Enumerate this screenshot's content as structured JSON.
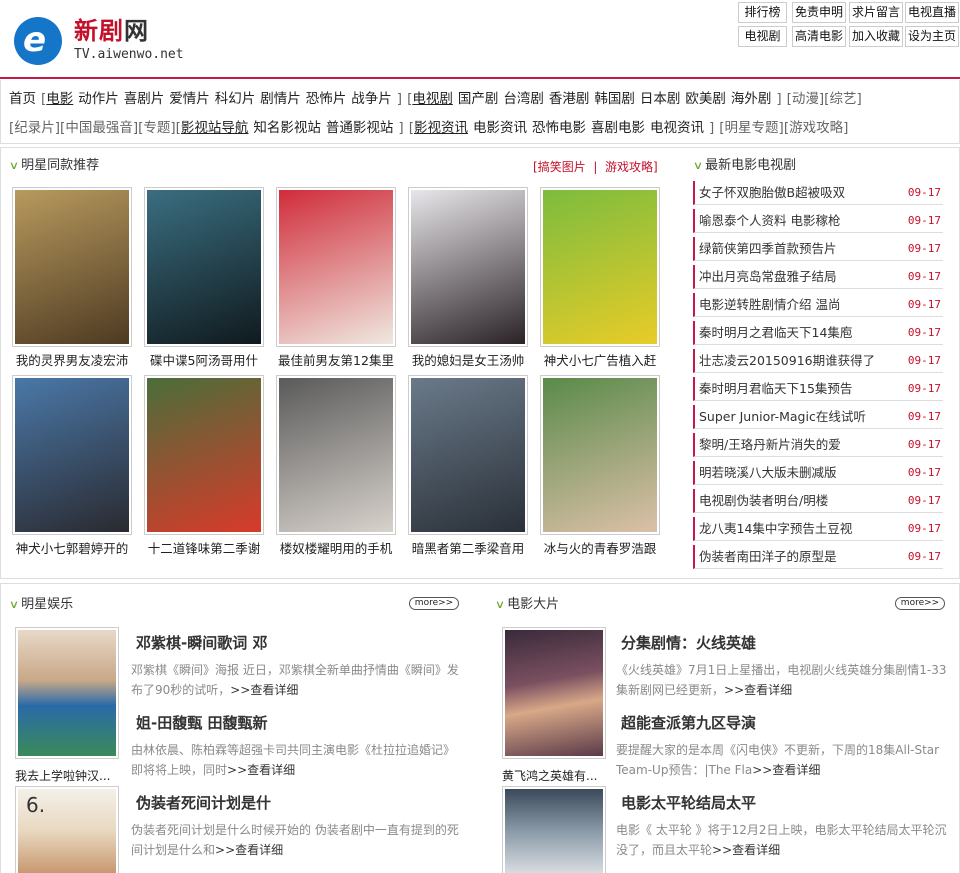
{
  "site": {
    "name_part1": "新剧",
    "name_part2": "网",
    "domain": "TV.aiwenwo.net"
  },
  "top_links": [
    "排行榜",
    "免责申明",
    "求片留言",
    "电视直播",
    "电视剧",
    "高清电影",
    "加入收藏",
    "设为主页"
  ],
  "nav": {
    "row1": [
      {
        "t": "首页"
      },
      {
        "t": "[",
        "b": 1
      },
      {
        "t": "电影",
        "u": 1
      },
      {
        "t": "动作片"
      },
      {
        "t": "喜剧片"
      },
      {
        "t": "爱情片"
      },
      {
        "t": "科幻片"
      },
      {
        "t": "剧情片"
      },
      {
        "t": "恐怖片"
      },
      {
        "t": "战争片"
      },
      {
        "t": "]",
        "b": 1
      },
      {
        "t": "[",
        "b": 1
      },
      {
        "t": "电视剧",
        "u": 1
      },
      {
        "t": "国产剧"
      },
      {
        "t": "台湾剧"
      },
      {
        "t": "香港剧"
      },
      {
        "t": "韩国剧"
      },
      {
        "t": "日本剧"
      },
      {
        "t": "欧美剧"
      },
      {
        "t": "海外剧"
      },
      {
        "t": "]",
        "b": 1
      },
      {
        "t": "[动漫]",
        "b": 1
      },
      {
        "t": "[综艺]",
        "b": 1
      }
    ],
    "row2": [
      {
        "t": "[纪录片]",
        "b": 1
      },
      {
        "t": "[中国最强音]",
        "b": 1
      },
      {
        "t": "[专题]",
        "b": 1
      },
      {
        "t": "[",
        "b": 1
      },
      {
        "t": "影视站导航",
        "u": 1
      },
      {
        "t": "知名影视站"
      },
      {
        "t": "普通影视站"
      },
      {
        "t": "]",
        "b": 1
      },
      {
        "t": "[",
        "b": 1
      },
      {
        "t": "影视资讯",
        "u": 1
      },
      {
        "t": "电影资讯"
      },
      {
        "t": "恐怖电影"
      },
      {
        "t": "喜剧电影"
      },
      {
        "t": "电视资讯"
      },
      {
        "t": "]",
        "b": 1
      },
      {
        "t": "[明星专题]",
        "b": 1
      },
      {
        "t": "[游戏攻略]",
        "b": 1
      }
    ]
  },
  "star_rec": {
    "title": "明星同款推荐",
    "tag_links": [
      "搞笑图片",
      "游戏攻略"
    ],
    "items": [
      {
        "label": "我的灵界男友凌宏沛",
        "c1": "#b89a5e",
        "c2": "#4e3a22"
      },
      {
        "label": "碟中谍5阿汤哥用什",
        "c1": "#3a6e80",
        "c2": "#101a1e"
      },
      {
        "label": "最佳前男友第12集里",
        "c1": "#d02c3a",
        "c2": "#f0e8e0"
      },
      {
        "label": "我的媳妇是女王汤帅",
        "c1": "#e8e6ea",
        "c2": "#2a2226"
      },
      {
        "label": "神犬小七广告植入赶",
        "c1": "#7cbc3e",
        "c2": "#e8cc28"
      },
      {
        "label": "神犬小七郭碧婷开的",
        "c1": "#4a78a8",
        "c2": "#2a2a30"
      },
      {
        "label": "十二道锋味第二季谢",
        "c1": "#4a6e3a",
        "c2": "#d83a2a"
      },
      {
        "label": "楼奴楼耀明用的手机",
        "c1": "#5a5a5a",
        "c2": "#d8d2cc"
      },
      {
        "label": "暗黑者第二季梁音用",
        "c1": "#6a7a8a",
        "c2": "#2a3038"
      },
      {
        "label": "冰与火的青春罗浩跟",
        "c1": "#5a8a4a",
        "c2": "#dcc0a8"
      }
    ]
  },
  "latest": {
    "title": "最新电影电视剧",
    "items": [
      {
        "t": "女子怀双胞胎傲B超被吸双",
        "d": "09-17"
      },
      {
        "t": "喻恩泰个人资料 电影稼枪",
        "d": "09-17"
      },
      {
        "t": "绿箭侠第四季首款预告片",
        "d": "09-17"
      },
      {
        "t": "冲出月亮岛常盘雅子结局",
        "d": "09-17"
      },
      {
        "t": "电影逆转胜剧情介绍 温尚",
        "d": "09-17"
      },
      {
        "t": "秦时明月之君临天下14集庖",
        "d": "09-17"
      },
      {
        "t": "壮志凌云20150916期谁获得了",
        "d": "09-17"
      },
      {
        "t": "秦时明月君临天下15集预告",
        "d": "09-17"
      },
      {
        "t": "Super Junior-Magic在线试听",
        "d": "09-17"
      },
      {
        "t": "黎明/王珞丹新片消失的爱",
        "d": "09-17"
      },
      {
        "t": "明若晓溪八大版未删减版",
        "d": "09-17"
      },
      {
        "t": "电视剧伪装者明台/明楼",
        "d": "09-17"
      },
      {
        "t": "龙八夷14集中字预告土豆视",
        "d": "09-17"
      },
      {
        "t": "伪装者南田洋子的原型是",
        "d": "09-17"
      }
    ]
  },
  "ent": {
    "title": "明星娱乐",
    "more": "more>>",
    "img_caption": "我去上学啦钟汉...",
    "bottom_caption": "6.",
    "articles": [
      {
        "title": "邓紫棋-瞬间歌词 邓",
        "desc": "邓紫棋《瞬间》海报 近日，邓紫棋全新单曲抒情曲《瞬间》发布了90秒的试听，",
        "go": ">>查看详细"
      },
      {
        "title": "姐-田馥甄 田馥甄新",
        "desc": "由林依晨、陈柏霖等超强卡司共同主演电影《杜拉拉追婚记》即将将上映，同时",
        "go": ">>查看详细"
      },
      {
        "title": "伪装者死间计划是什",
        "desc": "伪装者死间计划是什么时候开始的 伪装者剧中一直有提到的死间计划是什么和",
        "go": ">>查看详细"
      }
    ]
  },
  "movie": {
    "title": "电影大片",
    "more": "more>>",
    "img_caption": "黄飞鸿之英雄有...",
    "articles": [
      {
        "title": "分集剧情：火线英雄",
        "desc": "《火线英雄》7月1日上星播出，电视剧火线英雄分集剧情1-33集新剧网已经更新，",
        "go": ">>查看详细"
      },
      {
        "title": "超能查派第九区导演",
        "desc": "要提醒大家的是本周《闪电侠》不更新，下周的18集All-Star Team-Up预告：|The Fla",
        "go": ">>查看详细"
      },
      {
        "title": "电影太平轮结局太平",
        "desc": "电影《 太平轮 》将于12月2日上映，电影太平轮结局太平轮沉没了，而且太平轮",
        "go": ">>查看详细"
      }
    ]
  }
}
